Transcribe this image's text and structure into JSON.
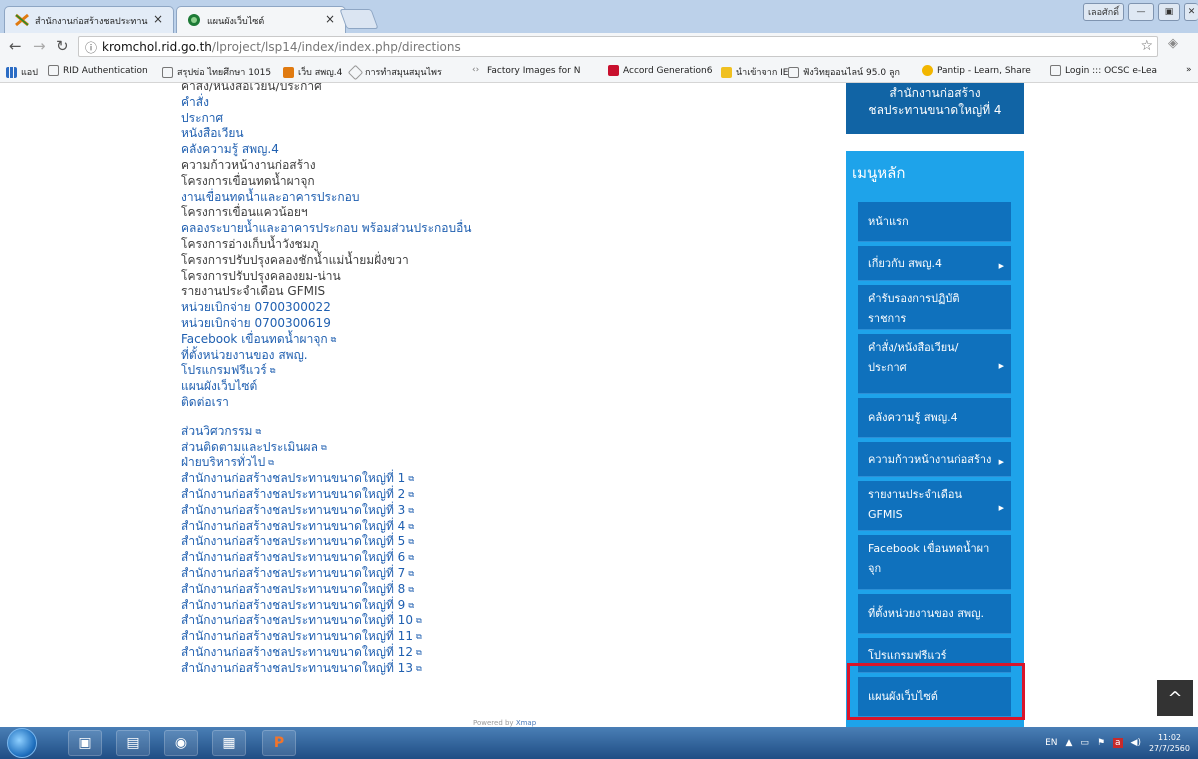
{
  "browser": {
    "tabs": [
      {
        "label": "สำนักงานก่อสร้างชลประทาน",
        "active": false
      },
      {
        "label": "แผนผังเว็บไซต์",
        "active": true
      }
    ],
    "window_user": "เลอศักดิ์",
    "address": {
      "domain": "kromchol.rid.go.th",
      "path": "/lproject/lsp14/index/index.php/directions"
    },
    "bookmarks": [
      "แอป",
      "RID Authentication",
      "สรุปข่อ ไทยศึกษา 1015",
      "เว็บ สพญ.4",
      "การทำสมุนสมุนไพร",
      "Factory Images for N",
      "Accord Generation6",
      "นำเข้าจาก IE",
      "ฟังวิทยุออนไลน์ 95.0 ลูก",
      "Pantip - Learn, Share",
      "Login ::: OCSC e-Lea"
    ],
    "bookmarks_more": "»"
  },
  "links_group1": [
    {
      "text": "คำสั่ง/หนังสือเวียน/ประกาศ",
      "style": "dark",
      "ext": false
    },
    {
      "text": "คำสั่ง",
      "style": "blue",
      "ext": false
    },
    {
      "text": "ประกาศ",
      "style": "blue",
      "ext": false
    },
    {
      "text": "หนังสือเวียน",
      "style": "blue",
      "ext": false
    },
    {
      "text": "คลังความรู้ สพญ.4",
      "style": "blue",
      "ext": false
    },
    {
      "text": "ความก้าวหน้างานก่อสร้าง",
      "style": "dark",
      "ext": false
    },
    {
      "text": "โครงการเขื่อนทดน้ำผาจุก",
      "style": "dark",
      "ext": false
    },
    {
      "text": "งานเขื่อนทดน้ำและอาคารประกอบ",
      "style": "blue",
      "ext": false
    },
    {
      "text": "โครงการเขื่อนแควน้อยฯ",
      "style": "dark",
      "ext": false
    },
    {
      "text": "คลองระบายน้ำและอาคารประกอบ พร้อมส่วนประกอบอื่น",
      "style": "blue",
      "ext": false
    },
    {
      "text": "โครงการอ่างเก็บน้ำวังชมภู",
      "style": "dark",
      "ext": false
    },
    {
      "text": "โครงการปรับปรุงคลองชักน้ำแม่น้ำยมฝั่งขวา",
      "style": "dark",
      "ext": false
    },
    {
      "text": "โครงการปรับปรุงคลองยม-น่าน",
      "style": "dark",
      "ext": false
    },
    {
      "text": "รายงานประจำเดือน GFMIS",
      "style": "dark",
      "ext": false
    },
    {
      "text": "หน่วยเบิกจ่าย 0700300022",
      "style": "blue",
      "ext": false
    },
    {
      "text": "หน่วยเบิกจ่าย 0700300619",
      "style": "blue",
      "ext": false
    },
    {
      "text": "Facebook เขื่อนทดน้ำผาจุก",
      "style": "blue",
      "ext": true
    },
    {
      "text": "ที่ตั้งหน่วยงานของ สพญ.",
      "style": "blue",
      "ext": false
    },
    {
      "text": "โปรแกรมฟรีแวร์",
      "style": "blue",
      "ext": true
    },
    {
      "text": "แผนผังเว็บไซต์",
      "style": "blue",
      "ext": false
    },
    {
      "text": "ติดต่อเรา",
      "style": "blue",
      "ext": false
    }
  ],
  "links_group2": [
    {
      "text": "ส่วนวิศวกรรม",
      "style": "blue",
      "ext": true
    },
    {
      "text": "ส่วนติดตามและประเมินผล",
      "style": "blue",
      "ext": true
    },
    {
      "text": "ฝ่ายบริหารทั่วไป",
      "style": "blue",
      "ext": true
    },
    {
      "text": "สำนักงานก่อสร้างชลประทานขนาดใหญ่ที่ 1",
      "style": "blue",
      "ext": true
    },
    {
      "text": "สำนักงานก่อสร้างชลประทานขนาดใหญ่ที่ 2",
      "style": "blue",
      "ext": true
    },
    {
      "text": "สำนักงานก่อสร้างชลประทานขนาดใหญ่ที่ 3",
      "style": "blue",
      "ext": true
    },
    {
      "text": "สำนักงานก่อสร้างชลประทานขนาดใหญ่ที่ 4",
      "style": "blue",
      "ext": true
    },
    {
      "text": "สำนักงานก่อสร้างชลประทานขนาดใหญ่ที่ 5",
      "style": "blue",
      "ext": true
    },
    {
      "text": "สำนักงานก่อสร้างชลประทานขนาดใหญ่ที่ 6",
      "style": "blue",
      "ext": true
    },
    {
      "text": "สำนักงานก่อสร้างชลประทานขนาดใหญ่ที่ 7",
      "style": "blue",
      "ext": true
    },
    {
      "text": "สำนักงานก่อสร้างชลประทานขนาดใหญ่ที่ 8",
      "style": "blue",
      "ext": true
    },
    {
      "text": "สำนักงานก่อสร้างชลประทานขนาดใหญ่ที่ 9",
      "style": "blue",
      "ext": true
    },
    {
      "text": "สำนักงานก่อสร้างชลประทานขนาดใหญ่ที่ 10",
      "style": "blue",
      "ext": true
    },
    {
      "text": "สำนักงานก่อสร้างชลประทานขนาดใหญ่ที่ 11",
      "style": "blue",
      "ext": true
    },
    {
      "text": "สำนักงานก่อสร้างชลประทานขนาดใหญ่ที่ 12",
      "style": "blue",
      "ext": true
    },
    {
      "text": "สำนักงานก่อสร้างชลประทานขนาดใหญ่ที่ 13",
      "style": "blue",
      "ext": true
    }
  ],
  "powered_by": {
    "prefix": "Powered by",
    "name": "Xmap"
  },
  "sidebar": {
    "badge_line1": "สำนักงานก่อสร้าง",
    "badge_line2": "ชลประทานขนาดใหญ่ที่ 4",
    "menu_title": "เมนูหลัก",
    "items": [
      {
        "lines": [
          "หน้าแรก"
        ],
        "arrow": false
      },
      {
        "lines": [
          "เกี่ยวกับ สพญ.4"
        ],
        "arrow": true
      },
      {
        "lines": [
          "คำรับรองการปฏิบัติ",
          "ราชการ"
        ],
        "arrow": false
      },
      {
        "lines": [
          "คำสั่ง/หนังสือเวียน/",
          "ประกาศ"
        ],
        "arrow": true
      },
      {
        "lines": [
          "คลังความรู้ สพญ.4"
        ],
        "arrow": false
      },
      {
        "lines": [
          "ความก้าวหน้างานก่อสร้าง"
        ],
        "arrow": true
      },
      {
        "lines": [
          "รายงานประจำเดือน",
          "GFMIS"
        ],
        "arrow": true
      },
      {
        "lines": [
          "Facebook เขื่อนทดน้ำผา",
          "จุก"
        ],
        "arrow": false
      },
      {
        "lines": [
          "ที่ตั้งหน่วยงานของ สพญ."
        ],
        "arrow": false
      },
      {
        "lines": [
          "โปรแกรมฟรีแวร์"
        ],
        "arrow": false
      },
      {
        "lines": [
          "แผนผังเว็บไซต์"
        ],
        "arrow": false
      }
    ]
  },
  "taskbar": {
    "lang": "EN",
    "time": "11:02",
    "date": "27/7/2560"
  },
  "colors": {
    "link_blue": "#1f5fb0",
    "menu_panel": "#1ea3ea",
    "menu_item": "#0f71bd",
    "highlight_red": "#d9152a"
  }
}
